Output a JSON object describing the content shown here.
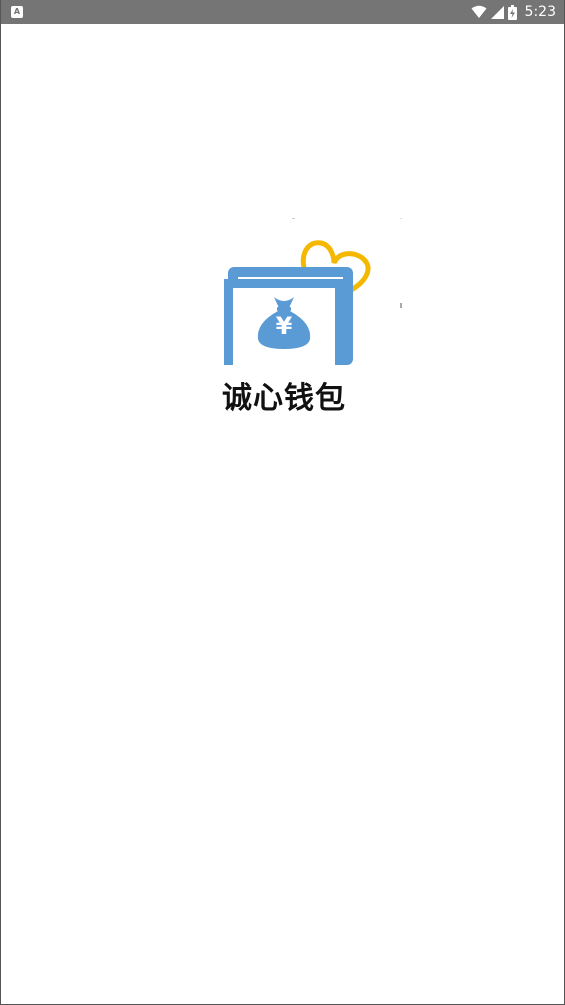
{
  "status_bar": {
    "notification_letter": "A",
    "time": "5:23",
    "icons": [
      "notification-a-icon",
      "wifi-icon",
      "cell-signal-icon",
      "battery-charging-icon"
    ]
  },
  "splash": {
    "app_name": "诚心钱包",
    "logo_icons": [
      "wallet-icon",
      "money-bag-icon",
      "heart-outline-icon"
    ],
    "currency_symbol": "¥"
  },
  "colors": {
    "status_bar": "#757575",
    "wallet_blue": "#5b9bd5",
    "heart_yellow": "#f5b800",
    "background": "#ffffff"
  }
}
